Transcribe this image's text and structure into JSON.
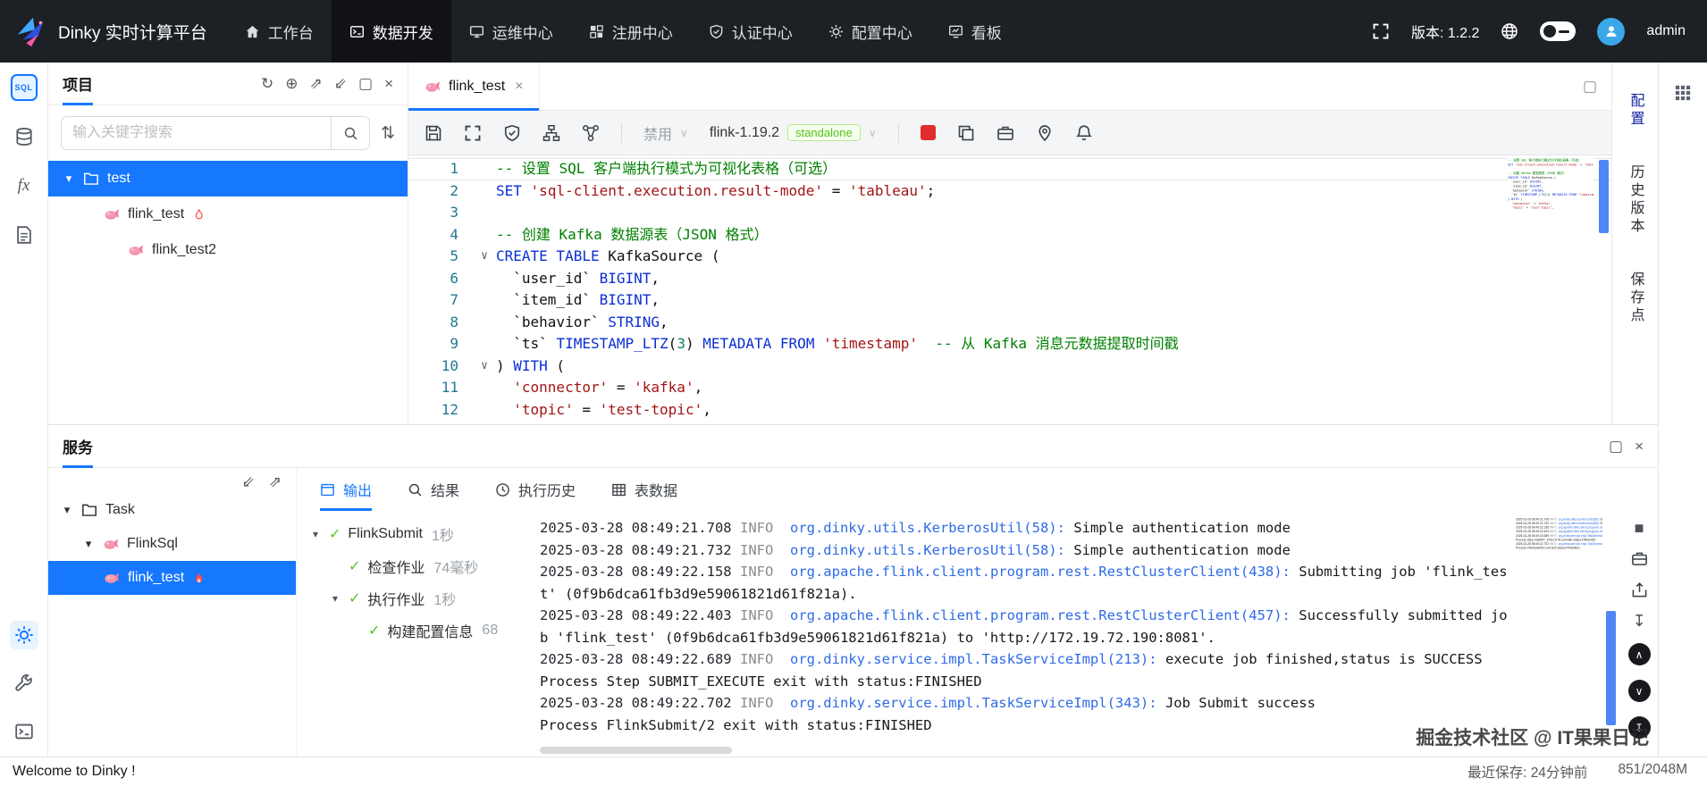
{
  "navbar": {
    "brand": "Dinky 实时计算平台",
    "items": [
      {
        "label": "工作台"
      },
      {
        "label": "数据开发"
      },
      {
        "label": "运维中心"
      },
      {
        "label": "注册中心"
      },
      {
        "label": "认证中心"
      },
      {
        "label": "配置中心"
      },
      {
        "label": "看板"
      }
    ],
    "version_label": "版本: 1.2.2",
    "user": "admin"
  },
  "icons": {
    "refresh": "↻",
    "plus_circle": "⊕",
    "expand_out": "⇗",
    "collapse_in": "⇙",
    "window_box": "▢",
    "close": "×",
    "sort": "⇅",
    "caret_down": "▾",
    "fold_chevron": "∨",
    "check": "✓",
    "stop_square": "■",
    "upload": "↥",
    "download": "↧",
    "chevron_up": "∧",
    "chevron_down": "∨",
    "select_caret": "∨"
  },
  "project_panel": {
    "title": "项目",
    "search_placeholder": "输入关键字搜索",
    "tree": [
      {
        "label": "test"
      },
      {
        "label": "flink_test"
      },
      {
        "label": "flink_test2"
      }
    ]
  },
  "editor": {
    "tab_title": "flink_test",
    "toolbar": {
      "mode": "禁用",
      "cluster": "flink-1.19.2",
      "cluster_tag": "standalone"
    },
    "code_lines": [
      {
        "n": 1,
        "active": true,
        "tokens": [
          {
            "c": "cm",
            "t": "-- 设置 SQL 客户端执行模式为可视化表格（可选）"
          }
        ]
      },
      {
        "n": 2,
        "tokens": [
          {
            "c": "kw",
            "t": "SET"
          },
          {
            "c": "pl",
            "t": " "
          },
          {
            "c": "str",
            "t": "'sql-client.execution.result-mode'"
          },
          {
            "c": "pl",
            "t": " = "
          },
          {
            "c": "str",
            "t": "'tableau'"
          },
          {
            "c": "pl",
            "t": ";"
          }
        ]
      },
      {
        "n": 3,
        "tokens": []
      },
      {
        "n": 4,
        "tokens": [
          {
            "c": "cm",
            "t": "-- 创建 Kafka 数据源表（JSON 格式）"
          }
        ]
      },
      {
        "n": 5,
        "fold": true,
        "tokens": [
          {
            "c": "kw",
            "t": "CREATE TABLE"
          },
          {
            "c": "pl",
            "t": " KafkaSource ("
          }
        ]
      },
      {
        "n": 6,
        "tokens": [
          {
            "c": "pl",
            "t": "  `user_id` "
          },
          {
            "c": "kw",
            "t": "BIGINT"
          },
          {
            "c": "pl",
            "t": ","
          }
        ]
      },
      {
        "n": 7,
        "tokens": [
          {
            "c": "pl",
            "t": "  `item_id` "
          },
          {
            "c": "kw",
            "t": "BIGINT"
          },
          {
            "c": "pl",
            "t": ","
          }
        ]
      },
      {
        "n": 8,
        "tokens": [
          {
            "c": "pl",
            "t": "  `behavior` "
          },
          {
            "c": "kw",
            "t": "STRING"
          },
          {
            "c": "pl",
            "t": ","
          }
        ]
      },
      {
        "n": 9,
        "tokens": [
          {
            "c": "pl",
            "t": "  `ts` "
          },
          {
            "c": "kw",
            "t": "TIMESTAMP_LTZ"
          },
          {
            "c": "pl",
            "t": "("
          },
          {
            "c": "num",
            "t": "3"
          },
          {
            "c": "pl",
            "t": ") "
          },
          {
            "c": "kw",
            "t": "METADATA FROM"
          },
          {
            "c": "pl",
            "t": " "
          },
          {
            "c": "str",
            "t": "'timestamp'"
          },
          {
            "c": "pl",
            "t": "  "
          },
          {
            "c": "cm",
            "t": "-- 从 Kafka 消息元数据提取时间戳"
          }
        ]
      },
      {
        "n": 10,
        "fold": true,
        "tokens": [
          {
            "c": "pl",
            "t": ") "
          },
          {
            "c": "kw",
            "t": "WITH"
          },
          {
            "c": "pl",
            "t": " ("
          }
        ]
      },
      {
        "n": 11,
        "tokens": [
          {
            "c": "pl",
            "t": "  "
          },
          {
            "c": "str",
            "t": "'connector'"
          },
          {
            "c": "pl",
            "t": " = "
          },
          {
            "c": "str",
            "t": "'kafka'"
          },
          {
            "c": "pl",
            "t": ","
          }
        ]
      },
      {
        "n": 12,
        "tokens": [
          {
            "c": "pl",
            "t": "  "
          },
          {
            "c": "str",
            "t": "'topic'"
          },
          {
            "c": "pl",
            "t": " = "
          },
          {
            "c": "str",
            "t": "'test-topic'"
          },
          {
            "c": "pl",
            "t": ","
          }
        ]
      }
    ]
  },
  "right_rail": {
    "tabs": [
      "配置",
      "历史版本",
      "保存点"
    ]
  },
  "service_panel": {
    "title": "服务",
    "tree": [
      {
        "label": "Task"
      },
      {
        "label": "FlinkSql"
      },
      {
        "label": "flink_test"
      }
    ],
    "tabs": [
      {
        "label": "输出"
      },
      {
        "label": "结果"
      },
      {
        "label": "执行历史"
      },
      {
        "label": "表数据"
      }
    ],
    "steps": [
      {
        "label": "FlinkSubmit",
        "duration": "1秒",
        "caret": true,
        "indent": 0
      },
      {
        "label": "检查作业",
        "duration": "74毫秒",
        "caret": false,
        "indent": 1
      },
      {
        "label": "执行作业",
        "duration": "1秒",
        "caret": true,
        "indent": 1
      },
      {
        "label": "构建配置信息",
        "duration": "68",
        "caret": false,
        "indent": 2
      }
    ],
    "log_lines": [
      {
        "time": "2025-03-28 08:49:21.708",
        "level": "INFO",
        "logger": "org.dinky.utils.KerberosUtil(58):",
        "msg": "Simple authentication mode"
      },
      {
        "time": "2025-03-28 08:49:21.732",
        "level": "INFO",
        "logger": "org.dinky.utils.KerberosUtil(58):",
        "msg": "Simple authentication mode"
      },
      {
        "time": "2025-03-28 08:49:22.158",
        "level": "INFO",
        "logger": "org.apache.flink.client.program.rest.RestClusterClient(438):",
        "msg": "Submitting job 'flink_test' (0f9b6dca61fb3d9e59061821d61f821a)."
      },
      {
        "time": "2025-03-28 08:49:22.403",
        "level": "INFO",
        "logger": "org.apache.flink.client.program.rest.RestClusterClient(457):",
        "msg": "Successfully submitted job 'flink_test' (0f9b6dca61fb3d9e59061821d61f821a) to 'http://172.19.72.190:8081'."
      },
      {
        "time": "2025-03-28 08:49:22.689",
        "level": "INFO",
        "logger": "org.dinky.service.impl.TaskServiceImpl(213):",
        "msg": "execute job finished,status is SUCCESS"
      },
      {
        "msg": "Process Step SUBMIT_EXECUTE exit with status:FINISHED"
      },
      {
        "time": "2025-03-28 08:49:22.702",
        "level": "INFO",
        "logger": "org.dinky.service.impl.TaskServiceImpl(343):",
        "msg": "Job Submit success"
      },
      {
        "msg": "Process FlinkSubmit/2 exit with status:FINISHED"
      }
    ]
  },
  "status_bar": {
    "welcome": "Welcome to Dinky !",
    "watermark": "掘金技术社区 @ IT果果日记",
    "last_save": "最近保存: 24分钟前",
    "memory": "851/2048M"
  }
}
